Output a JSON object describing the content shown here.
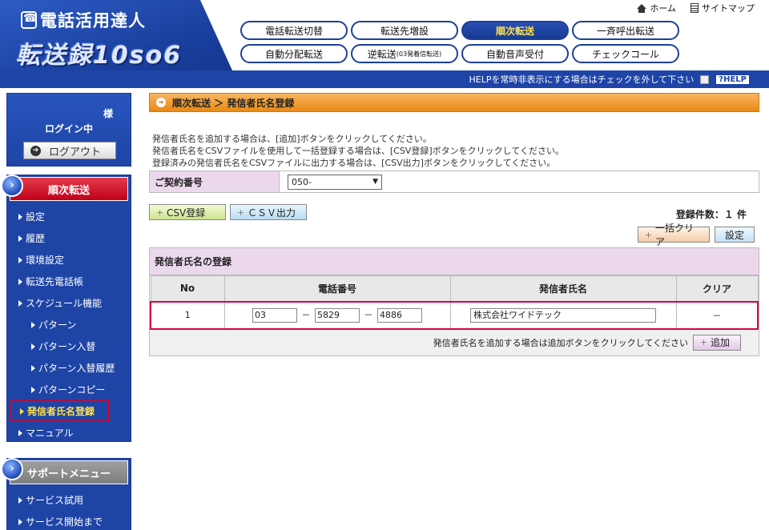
{
  "header": {
    "logo_top": "電話活用達人",
    "logo_main": "転送録10so6",
    "home_link": "ホーム",
    "sitemap_link": "サイトマップ",
    "nav": [
      {
        "label": "電話転送切替",
        "active": false
      },
      {
        "label": "転送先増設",
        "active": false
      },
      {
        "label": "順次転送",
        "active": true
      },
      {
        "label": "一斉呼出転送",
        "active": false
      },
      {
        "label": "自動分配転送",
        "active": false
      },
      {
        "label": "逆転送",
        "sub": "(03発着信転送)",
        "active": false
      },
      {
        "label": "自動音声受付",
        "active": false
      },
      {
        "label": "チェックコール",
        "active": false
      }
    ],
    "help_text": "HELPを常時非表示にする場合はチェックを外して下さい",
    "help_badge": "?HELP"
  },
  "sidebar": {
    "user_suffix": "様",
    "login_state": "ログイン中",
    "logout_label": "ログアウト",
    "section_main": "順次転送",
    "menu": [
      {
        "label": "設定",
        "level": 0
      },
      {
        "label": "履歴",
        "level": 0
      },
      {
        "label": "環境設定",
        "level": 0
      },
      {
        "label": "転送先電話帳",
        "level": 0
      },
      {
        "label": "スケジュール機能",
        "level": 0
      },
      {
        "label": "パターン",
        "level": 1
      },
      {
        "label": "パターン入替",
        "level": 1
      },
      {
        "label": "パターン入替履歴",
        "level": 1
      },
      {
        "label": "パターンコピー",
        "level": 1
      },
      {
        "label": "発信者氏名登録",
        "level": 0,
        "current": true
      },
      {
        "label": "マニュアル",
        "level": 0
      }
    ],
    "section_support": "サポートメニュー",
    "support_menu": [
      {
        "label": "サービス試用"
      },
      {
        "label": "サービス開始まで"
      }
    ]
  },
  "main": {
    "breadcrumb": "順次転送 ＞ 発信者氏名登録",
    "intro_lines": [
      "発信者氏名を追加する場合は、[追加]ボタンをクリックしてください。",
      "発信者氏名をCSVファイルを使用して一括登録する場合は、[CSV登録]ボタンをクリックしてください。",
      "登録済みの発信者氏名をCSVファイルに出力する場合は、[CSV出力]ボタンをクリックしてください。"
    ],
    "contract_label": "ご契約番号",
    "contract_value": "050-",
    "csv_register": "CSV登録",
    "csv_output": "ＣＳＶ出力",
    "count_text": "登録件数：１ 件",
    "clear_all": "一括クリア",
    "settings": "設定",
    "panel_title": "発信者氏名の登録",
    "columns": [
      "No",
      "電話番号",
      "発信者氏名",
      "クリア"
    ],
    "rows": [
      {
        "no": "1",
        "tel1": "03",
        "tel2": "5829",
        "tel3": "4886",
        "name": "株式会社ワイドテック",
        "clear": "－"
      }
    ],
    "dash": "－",
    "add_hint": "発信者氏名を追加する場合は追加ボタンをクリックしてください",
    "add_button": "追加"
  }
}
